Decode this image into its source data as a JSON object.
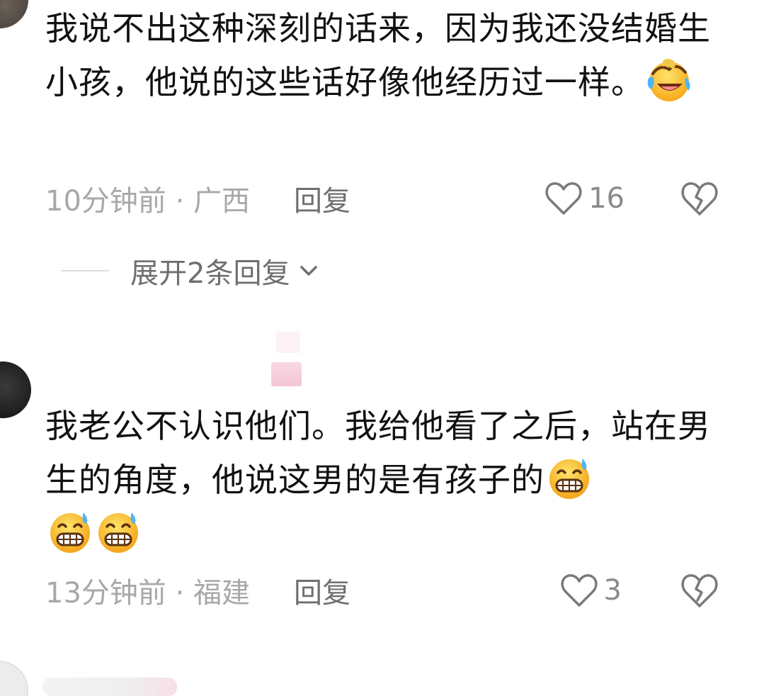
{
  "comments": [
    {
      "text": "我说不出这种深刻的话来，因为我还没结婚生小孩，他说的这些话好像他经历过一样。",
      "emoji": [
        "face-with-tears-of-joy-emoji"
      ],
      "time_location": "10分钟前 · 广西",
      "reply_label": "回复",
      "like_count": "16",
      "expand_replies_label": "展开2条回复"
    },
    {
      "text": "我老公不认识他们。我给他看了之后，站在男生的角度，他说这男的是有孩子的",
      "emoji": [
        "grinning-face-with-sweat-emoji",
        "grinning-face-with-sweat-emoji",
        "grinning-face-with-sweat-emoji"
      ],
      "time_location": "13分钟前 · 福建",
      "reply_label": "回复",
      "like_count": "3"
    }
  ],
  "icons": {
    "like": "heart-outline-icon",
    "dislike": "broken-heart-icon",
    "expand": "chevron-down-icon"
  },
  "colors": {
    "text": "#111111",
    "meta": "#a8a8a8",
    "reply": "#6f6f6f",
    "accent_pink": "#f3bfd1"
  }
}
